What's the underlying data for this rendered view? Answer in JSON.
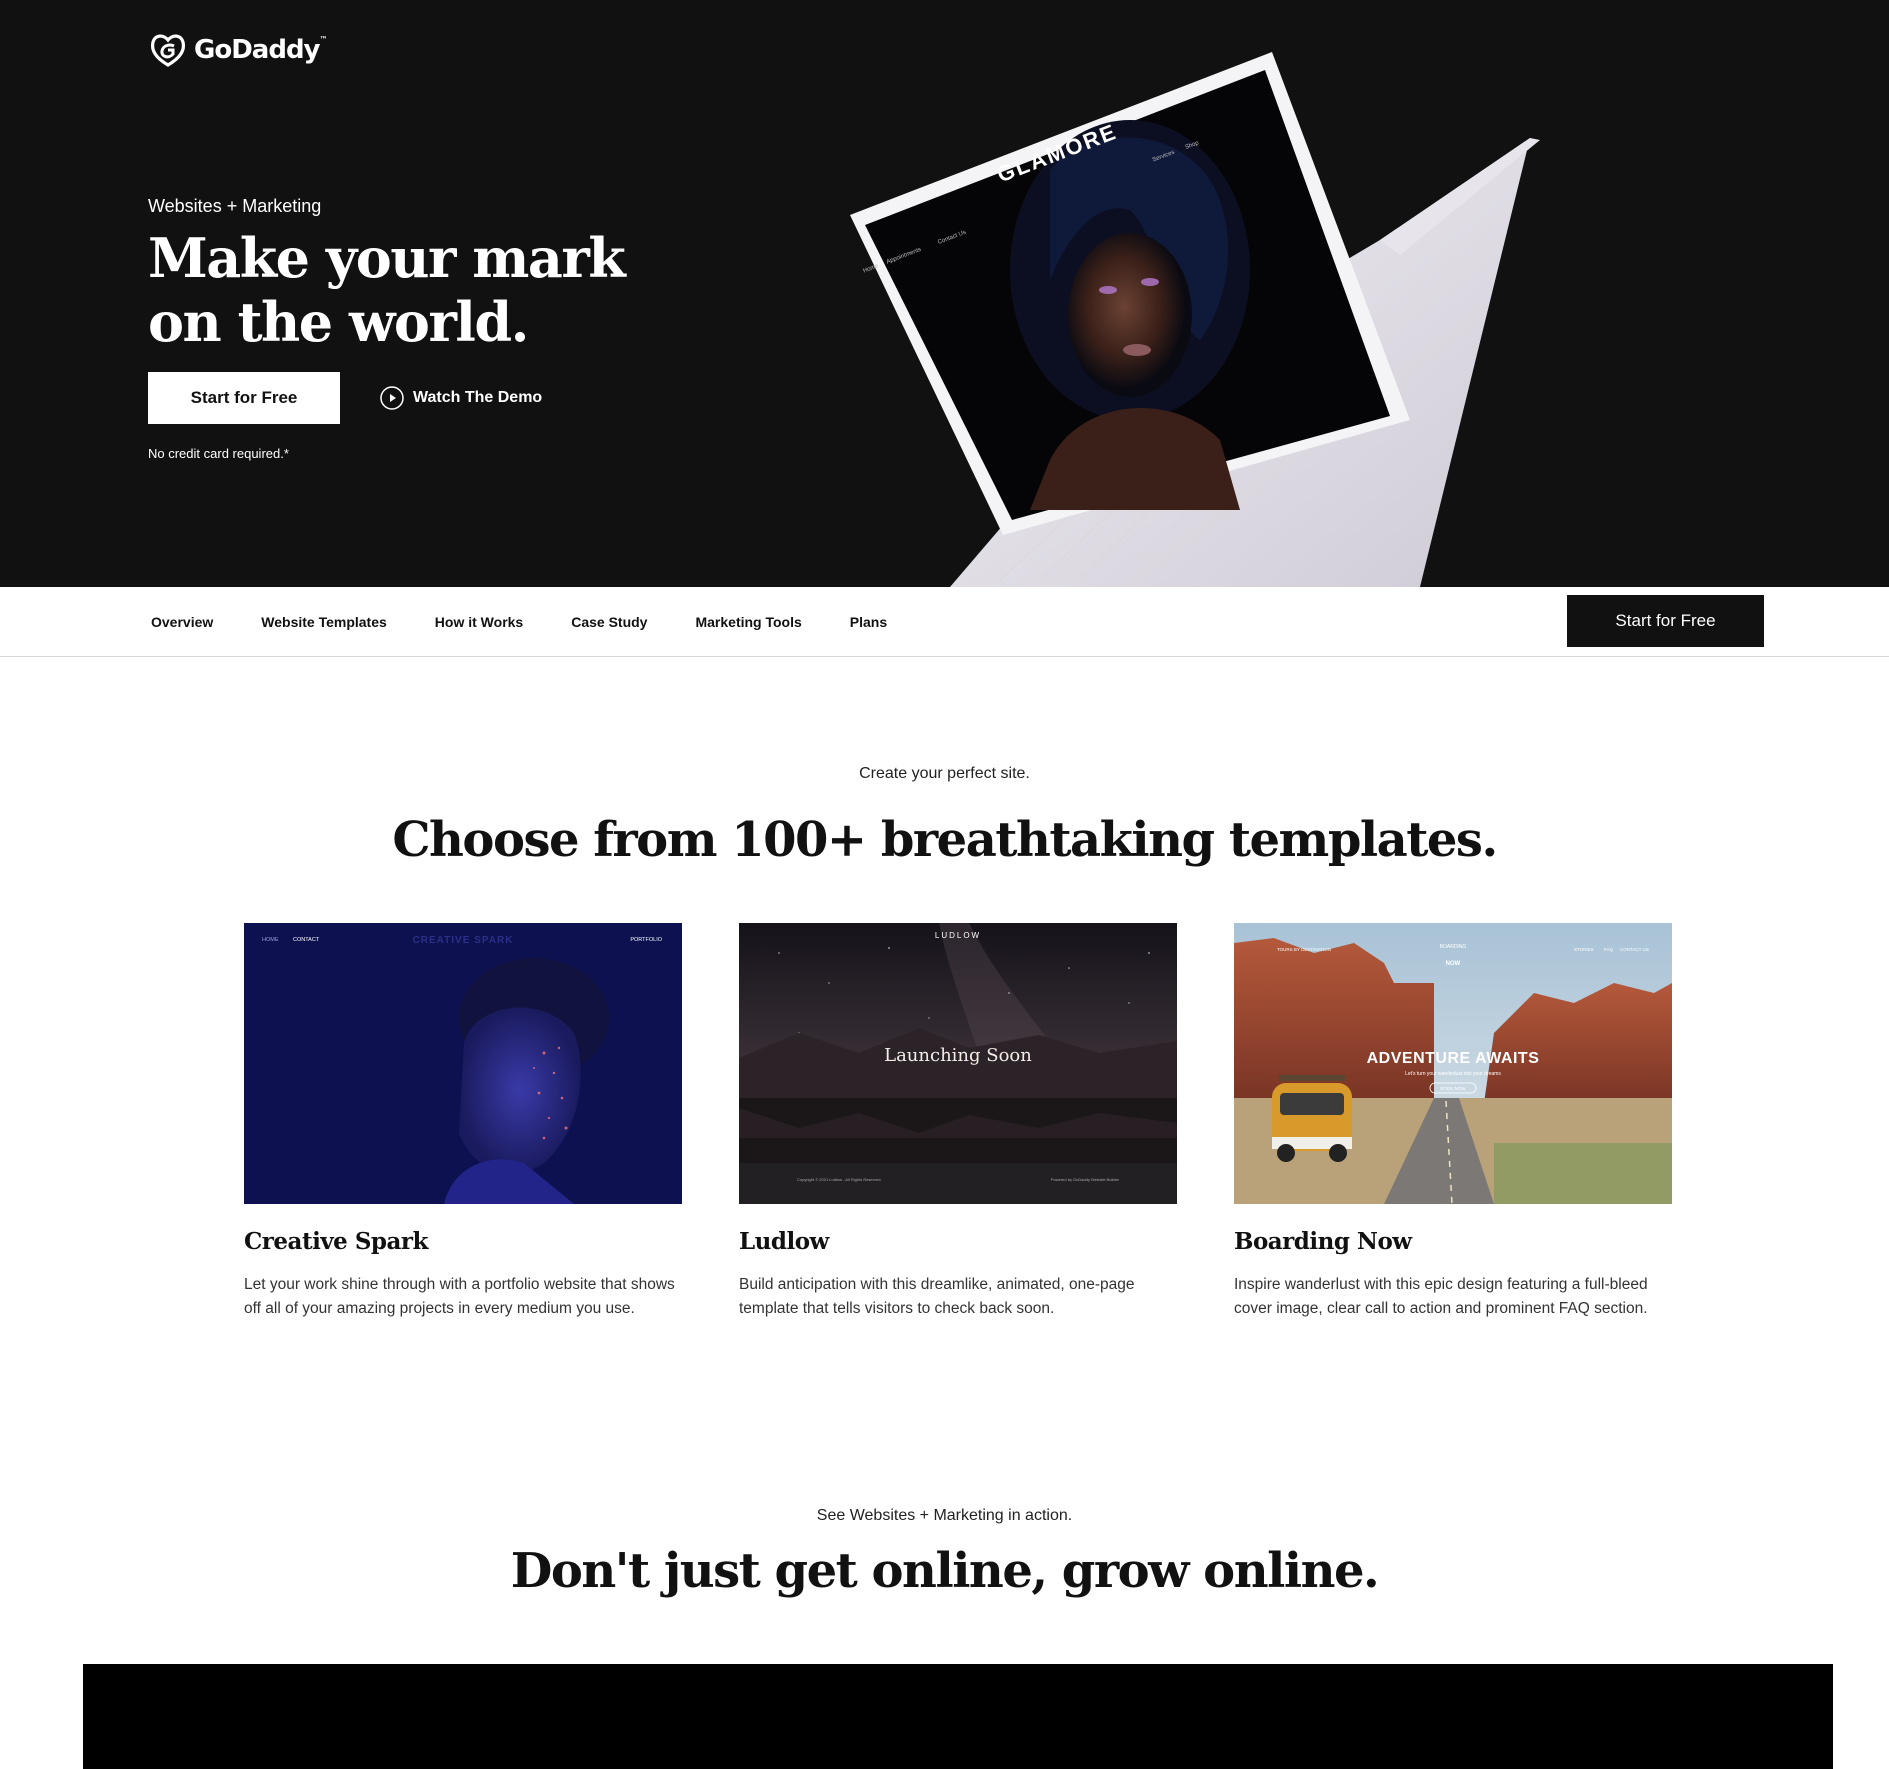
{
  "brand": {
    "name": "GoDaddy",
    "tm": "™"
  },
  "hero": {
    "eyebrow": "Websites + Marketing",
    "title_line1": "Make your mark",
    "title_line2": "on the world.",
    "cta_label": "Start for Free",
    "demo_label": "Watch The Demo",
    "note": "No credit card required.*",
    "laptop_screen": {
      "brand": "GLAMORE",
      "nav_items": [
        "Home",
        "Appointments",
        "Contact Us",
        "Services",
        "Shop"
      ]
    }
  },
  "subnav": {
    "links": [
      "Overview",
      "Website Templates",
      "How it Works",
      "Case Study",
      "Marketing Tools",
      "Plans"
    ],
    "cta_label": "Start for Free"
  },
  "templates": {
    "eyebrow": "Create your perfect site.",
    "title": "Choose from 100+ breathtaking templates.",
    "cards": [
      {
        "title": "Creative Spark",
        "description": "Let your work shine through with a portfolio website that shows off all of your amazing projects in every medium you use.",
        "preview": {
          "nav_left": [
            "HOME",
            "CONTACT"
          ],
          "brand": "CREATIVE SPARK",
          "nav_right": "PORTFOLIO"
        }
      },
      {
        "title": "Ludlow",
        "description": "Build anticipation with this dreamlike, animated, one-page template that tells visitors to check back soon.",
        "preview": {
          "brand": "LUDLOW",
          "headline": "Launching Soon",
          "footer_left": "Copyright © 2021 Ludlow - All Rights Reserved.",
          "footer_right": "Powered by GoDaddy Website Builder"
        }
      },
      {
        "title": "Boarding Now",
        "description": "Inspire wanderlust with this epic design featuring a full-bleed cover image, clear call to action and prominent FAQ section.",
        "preview": {
          "brand_line1": "BOARDING",
          "brand_line2": "NOW",
          "headline": "ADVENTURE AWAITS",
          "sub": "Let's turn your wanderlust into your dreams",
          "button": "BOOK NOW",
          "nav_left": "TOURS BY DESTINATION",
          "nav_right": [
            "STORIES",
            "FAQ",
            "CONTACT US"
          ]
        }
      }
    ]
  },
  "action": {
    "eyebrow": "See Websites + Marketing in action.",
    "title": "Don't just get online, grow online."
  }
}
